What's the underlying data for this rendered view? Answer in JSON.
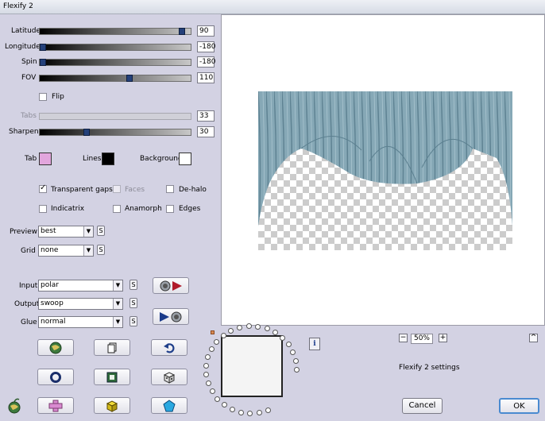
{
  "window": {
    "title": "Flexify 2"
  },
  "sliders": [
    {
      "label": "Latitude",
      "value": "90",
      "fraction": 0.96,
      "enabled": true
    },
    {
      "label": "Longitude",
      "value": "-180",
      "fraction": 0.0,
      "enabled": true
    },
    {
      "label": "Spin",
      "value": "-180",
      "fraction": 0.0,
      "enabled": true
    },
    {
      "label": "FOV",
      "value": "110",
      "fraction": 0.6,
      "enabled": true
    },
    {
      "label": "Tabs",
      "value": "33",
      "fraction": 0.33,
      "enabled": false
    },
    {
      "label": "Sharpen",
      "value": "30",
      "fraction": 0.3,
      "enabled": true
    }
  ],
  "flip": {
    "label": "Flip",
    "checked": false
  },
  "colors": {
    "tab": {
      "label": "Tab",
      "color": "#e2a6dd"
    },
    "lines": {
      "label": "Lines",
      "color": "#000000"
    },
    "background": {
      "label": "Background",
      "color": "#ffffff"
    }
  },
  "options": {
    "transparent_gaps": {
      "label": "Transparent gaps",
      "checked": true
    },
    "faces": {
      "label": "Faces",
      "checked": false,
      "enabled": false
    },
    "de_halo": {
      "label": "De-halo",
      "checked": false
    },
    "indicatrix": {
      "label": "Indicatrix",
      "checked": false
    },
    "anamorph": {
      "label": "Anamorph",
      "checked": false
    },
    "edges": {
      "label": "Edges",
      "checked": false
    }
  },
  "preview_select": {
    "label": "Preview",
    "value": "best"
  },
  "grid_select": {
    "label": "Grid",
    "value": "none"
  },
  "input_select": {
    "label": "Input",
    "value": "polar"
  },
  "output_select": {
    "label": "Output",
    "value": "swoop"
  },
  "glue_select": {
    "label": "Glue",
    "value": "normal"
  },
  "s_button": "S",
  "zoom": {
    "minus": "−",
    "value": "50%",
    "plus": "+"
  },
  "settings_label": "Flexify 2 settings",
  "info_button": "i",
  "collapse_button": "^",
  "cancel_button": "Cancel",
  "ok_button": "OK",
  "accent_color": "#24407a",
  "preview_image_color": "#7fa3b3"
}
